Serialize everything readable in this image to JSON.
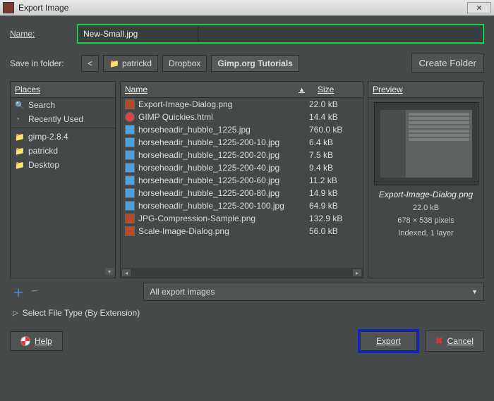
{
  "title": "Export Image",
  "name_label": "Name:",
  "filename": "New-Small.jpg",
  "save_in_folder_label": "Save in folder:",
  "path_segments": [
    "patrickd",
    "Dropbox",
    "Gimp.org Tutorials"
  ],
  "create_folder_label": "Create Folder",
  "places_header": "Places",
  "places_top": [
    {
      "label": "Search",
      "icon": "search"
    },
    {
      "label": "Recently Used",
      "icon": "clock"
    }
  ],
  "places_folders": [
    {
      "label": "gimp-2.8.4"
    },
    {
      "label": "patrickd"
    },
    {
      "label": "Desktop"
    }
  ],
  "file_columns": {
    "name": "Name",
    "size": "Size"
  },
  "files": [
    {
      "name": "Export-Image-Dialog.png",
      "size": "22.0 kB",
      "type": "png"
    },
    {
      "name": "GIMP Quickies.html",
      "size": "14.4 kB",
      "type": "html"
    },
    {
      "name": "horseheadir_hubble_1225.jpg",
      "size": "760.0 kB",
      "type": "jpg"
    },
    {
      "name": "horseheadir_hubble_1225-200-10.jpg",
      "size": "6.4 kB",
      "type": "jpg"
    },
    {
      "name": "horseheadir_hubble_1225-200-20.jpg",
      "size": "7.5 kB",
      "type": "jpg"
    },
    {
      "name": "horseheadir_hubble_1225-200-40.jpg",
      "size": "9.4 kB",
      "type": "jpg"
    },
    {
      "name": "horseheadir_hubble_1225-200-60.jpg",
      "size": "11.2 kB",
      "type": "jpg"
    },
    {
      "name": "horseheadir_hubble_1225-200-80.jpg",
      "size": "14.9 kB",
      "type": "jpg"
    },
    {
      "name": "horseheadir_hubble_1225-200-100.jpg",
      "size": "64.9 kB",
      "type": "jpg"
    },
    {
      "name": "JPG-Compression-Sample.png",
      "size": "132.9 kB",
      "type": "png"
    },
    {
      "name": "Scale-Image-Dialog.png",
      "size": "56.0 kB",
      "type": "png"
    }
  ],
  "preview_header": "Preview",
  "preview_file": "Export-Image-Dialog.png",
  "preview_size": "22.0 kB",
  "preview_dims": "678 × 538 pixels",
  "preview_mode": "Indexed, 1 layer",
  "filter_label": "All export images",
  "filetype_label": "Select File Type (By Extension)",
  "help_label": "Help",
  "export_label": "Export",
  "cancel_label": "Cancel"
}
